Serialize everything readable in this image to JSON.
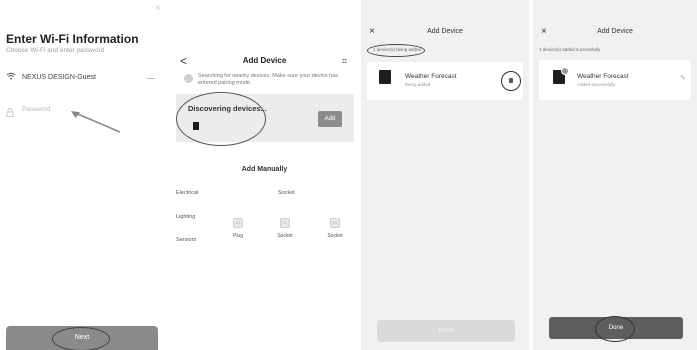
{
  "screen1": {
    "close_glyph": "×",
    "title": "Enter Wi-Fi Information",
    "subtitle": "Choose Wi-Fi and enter password",
    "wifi_icon": "wifi-icon",
    "ssid": "NEXUS DESIGN-Guest",
    "password_placeholder": "Password",
    "next_label": "Next"
  },
  "screen2": {
    "back_glyph": "<",
    "title": "Add Device",
    "scan_glyph": "⌗",
    "searching_text": "Searching for nearby devices. Make sure your device has entered pairing mode.",
    "discovering_text": "Discovering devices...",
    "add_label": "Add",
    "manual_title": "Add Manually",
    "categories": [
      "Electrical",
      "Lighting",
      "Sensors"
    ],
    "socket_header": "Socket",
    "devices": [
      "Plug",
      "Socket",
      "Socket"
    ]
  },
  "screen3": {
    "close_glyph": "×",
    "title": "Add Device",
    "status": "1 device(s) being added",
    "device_name": "Weather Forecast",
    "device_status": "Being added",
    "done_label": "Done"
  },
  "screen4": {
    "close_glyph": "×",
    "title": "Add Device",
    "status": "1 device(s) added successfully",
    "device_name": "Weather Forecast",
    "device_status": "Added successfully",
    "edit_glyph": "✎",
    "done_label": "Done"
  }
}
